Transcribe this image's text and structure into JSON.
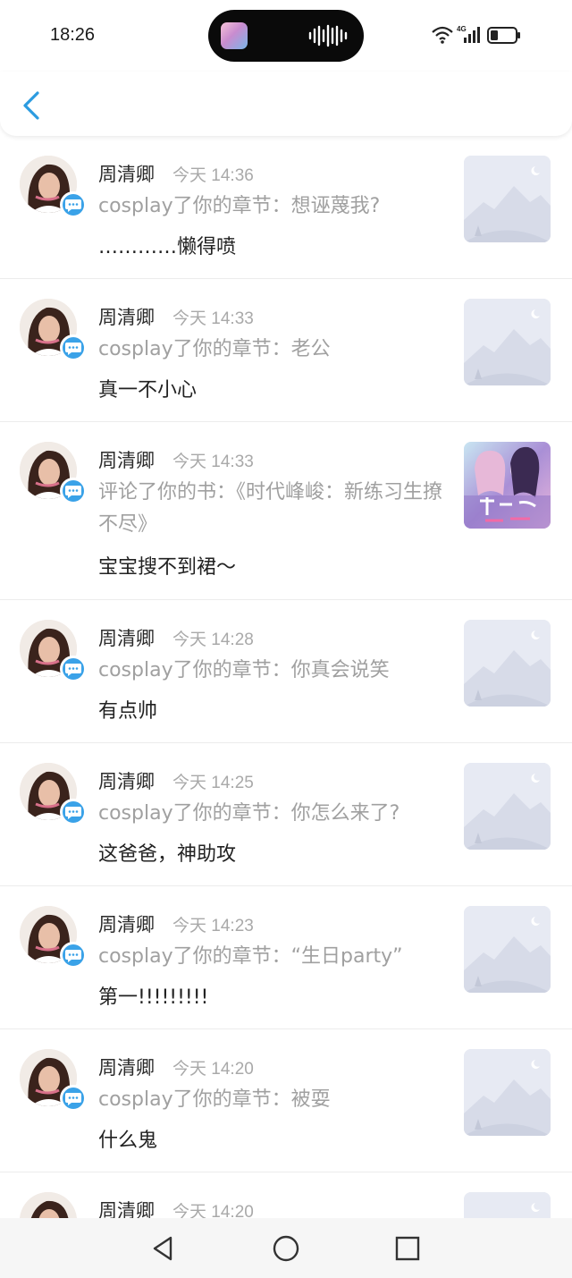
{
  "status_bar": {
    "time": "18:26",
    "network": "4G"
  },
  "header": {
    "back_icon": "chevron-left-icon"
  },
  "notifications": [
    {
      "name": "周清卿",
      "time": "今天 14:36",
      "description": "cosplay了你的章节：想诬蔑我?",
      "reply": "…………懒得喷",
      "thumb": "placeholder"
    },
    {
      "name": "周清卿",
      "time": "今天 14:33",
      "description": "cosplay了你的章节：老公",
      "reply": "真一不小心",
      "thumb": "placeholder"
    },
    {
      "name": "周清卿",
      "time": "今天 14:33",
      "description": "评论了你的书：《时代峰峻：新练习生撩不尽》",
      "reply": "宝宝搜不到裙～",
      "thumb": "cover"
    },
    {
      "name": "周清卿",
      "time": "今天 14:28",
      "description": "cosplay了你的章节：你真会说笑",
      "reply": "有点帅",
      "thumb": "placeholder"
    },
    {
      "name": "周清卿",
      "time": "今天 14:25",
      "description": "cosplay了你的章节：你怎么来了?",
      "reply": "这爸爸，神助攻",
      "thumb": "placeholder"
    },
    {
      "name": "周清卿",
      "time": "今天 14:23",
      "description": "cosplay了你的章节：“生日party”",
      "reply": "第一!!!!!!!!!",
      "thumb": "placeholder"
    },
    {
      "name": "周清卿",
      "time": "今天 14:20",
      "description": "cosplay了你的章节：被耍",
      "reply": "什么鬼",
      "thumb": "placeholder"
    },
    {
      "name": "周清卿",
      "time": "今天 14:20",
      "description": "",
      "reply": "",
      "thumb": "placeholder"
    }
  ],
  "nav": {
    "back": "triangle-back-icon",
    "home": "circle-home-icon",
    "recents": "square-recents-icon"
  },
  "colors": {
    "accent": "#3aa2e8",
    "name": "#2a2a2a",
    "meta": "#a9a9a9",
    "reply": "#222222",
    "divider": "#ececec"
  }
}
